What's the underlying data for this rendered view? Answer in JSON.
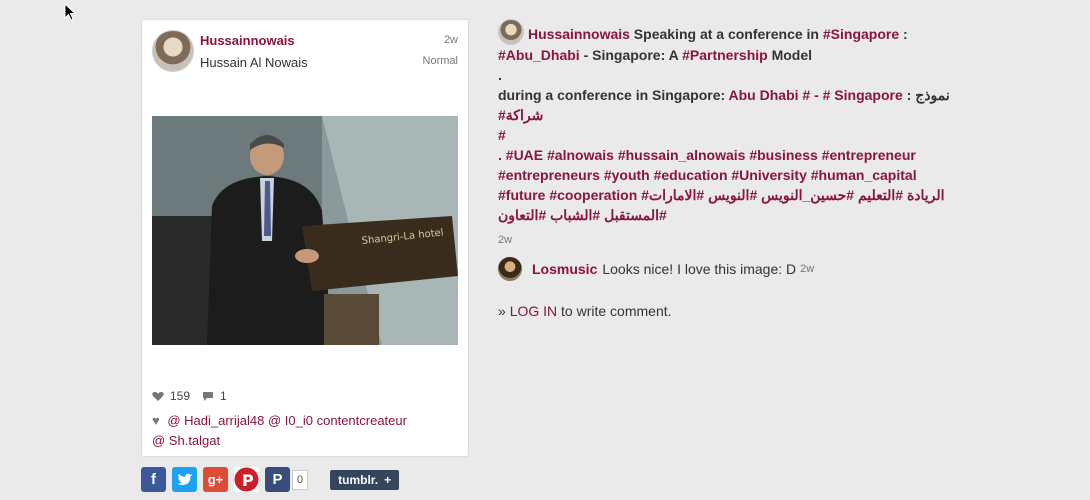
{
  "card": {
    "username": "Hussainnowais",
    "full_name": "Hussain Al Nowais",
    "time": "2w",
    "filter": "Normal",
    "likes_count": "159",
    "comments_count": "1",
    "likers": [
      "@ Hadi_arrijal48",
      "@ I0_i0",
      "contentcreateur",
      "@ Sh.talgat"
    ],
    "photo_sign": "Shangri-La hotel"
  },
  "share": {
    "count": "0",
    "tumblr_label": "tumblr.",
    "tumblr_plus": "+"
  },
  "post": {
    "username": "Hussainnowais",
    "line1_text": " Speaking at a conference in ",
    "tag_singapore": "#Singapore",
    "line1_end": " :",
    "tag_abudhabi": "#Abu_Dhabi",
    "line2_mid": " - Singapore: A ",
    "tag_partnership": "#Partnership",
    "line2_end": " Model",
    "dot1": ".",
    "line3_text": "during a conference in Singapore: ",
    "line3_abu": "Abu Dhabi # - # Singapore",
    "line3_arabic": " : نموذج",
    "line4_tag": "#شراكة",
    "line5_dot": "#",
    "hashtags_en": ". #UAE #alnowais #hussain_alnowais #business #entrepreneur #entrepreneurs #youth #education #University #human_capital #future #cooperation",
    "hashtags_ar": " #الريادة #التعليم #حسين_النويس #النويس #الامارات #المستقبل #الشباب #التعاون",
    "time": "2w"
  },
  "comment": {
    "username": "Losmusic",
    "text": "Looks nice! I love this image: D",
    "time": "2w"
  },
  "login": {
    "prefix": "» ",
    "link": "LOG IN",
    "suffix": " to write comment."
  },
  "colors": {
    "accent": "#8b1538",
    "background": "#eaeaea"
  }
}
